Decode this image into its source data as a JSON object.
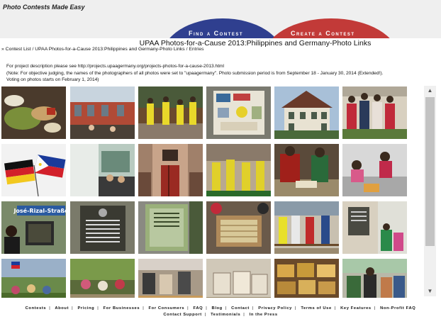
{
  "header": {
    "tagline": "Photo Contests Made Easy",
    "nav_find": "Find a Contest",
    "nav_create": "Create a Contest"
  },
  "page_title": "UPAA Photos-for-a-Cause 2013:Philippines and Germany-Photo Links",
  "breadcrumb": {
    "prefix": "»",
    "contest_list": "Contest List",
    "contest": "UPAA Photos-for-a-Cause 2013:Philippines and Germany-Photo Links",
    "current": "Entries"
  },
  "description": {
    "line1": "For project description please see http://projects.upaagermany.org/projects-photos-for-a-cause-2013.html",
    "line2": "(Note: For objective judging, the names of the photographers of all photos were set to \"upaagermany\". Photo submission period is from September 18 - January 30, 2014 (Extended!).",
    "line3": "Voting on photos starts on February 1, 2014)"
  },
  "thumbnail_signs": {
    "rizal_street_sign": "José-Rizal-Straße"
  },
  "scrollbar": {
    "up_icon": "▲",
    "down_icon": "▼"
  },
  "footer": {
    "row1": [
      "Contests",
      "About",
      "Pricing",
      "For Businesses",
      "For Consumers",
      "FAQ",
      "Blog",
      "Contact",
      "Privacy Policy",
      "Terms of Use",
      "Key Features",
      "Non-Profit FAQ"
    ],
    "row2": [
      "Contact Support",
      "Testimonials",
      "In the Press"
    ]
  }
}
